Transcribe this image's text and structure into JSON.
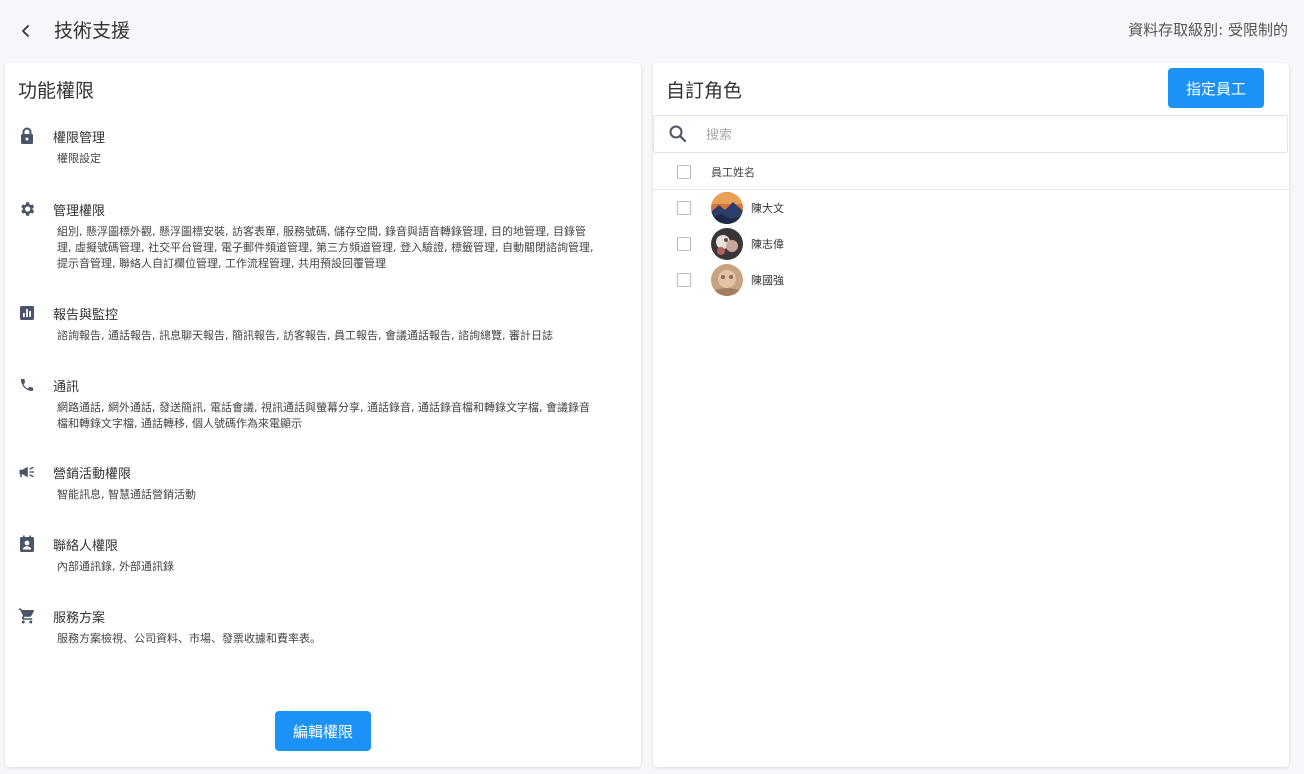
{
  "header": {
    "title": "技術支援",
    "access_level": "資料存取級別: 受限制的"
  },
  "permissions_panel": {
    "title": "功能權限",
    "sections": [
      {
        "icon": "lock-icon",
        "title": "權限管理",
        "desc": "權限設定"
      },
      {
        "icon": "gear-icon",
        "title": "管理權限",
        "desc": "組別, 懸浮圖標外觀, 懸浮圖標安裝, 訪客表單, 服務號碼, 儲存空間, 錄音與語音轉錄管理, 目的地管理, 目錄管理, 虛擬號碼管理, 社交平台管理, 電子郵件頻道管理, 第三方頻道管理, 登入驗證, 標籤管理, 自動關閉諮詢管理, 提示音管理, 聯絡人自訂欄位管理, 工作流程管理, 共用預設回覆管理"
      },
      {
        "icon": "report-chart-icon",
        "title": "報告與監控",
        "desc": "諮詢報告, 通話報告, 訊息聊天報告, 簡訊報告, 訪客報告, 員工報告, 會議通話報告, 諮詢總覽, 審計日誌"
      },
      {
        "icon": "phone-icon",
        "title": "通訊",
        "desc": "網路通話, 網外通話, 發送簡訊, 電話會議, 視訊通話與螢幕分享, 通話錄音, 通話錄音檔和轉錄文字檔, 會議錄音檔和轉錄文字檔, 通話轉移, 個人號碼作為來電顯示"
      },
      {
        "icon": "megaphone-icon",
        "title": "營銷活動權限",
        "desc": "智能訊息, 智慧通話營銷活動"
      },
      {
        "icon": "contact-card-icon",
        "title": "聯絡人權限",
        "desc": "內部通訊錄, 外部通訊錄"
      },
      {
        "icon": "cart-icon",
        "title": "服務方案",
        "desc": "服務方案檢視、公司資料、市場、發票收據和費率表。"
      }
    ],
    "edit_button": "編輯權限"
  },
  "roles_panel": {
    "title": "自訂角色",
    "assign_button": "指定員工",
    "search_placeholder": "搜索",
    "column_header": "員工姓名",
    "employees": [
      {
        "name": "陳大文"
      },
      {
        "name": "陳志偉"
      },
      {
        "name": "陳國強"
      }
    ]
  },
  "colors": {
    "primary": "#1a92f8",
    "icon": "#4a5568",
    "background": "#f5f7fb"
  }
}
